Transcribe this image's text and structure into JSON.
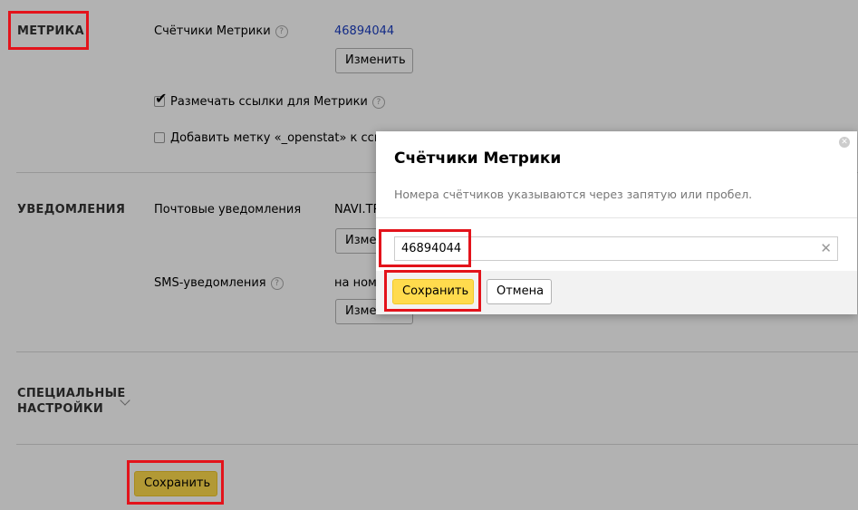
{
  "metrika": {
    "section_title": "МЕТРИКА",
    "counters_label": "Счётчики Метрики",
    "counters_value": "46894044",
    "change_button": "Изменить",
    "mark_links_label": "Размечать ссылки для Метрики",
    "openstat_label": "Добавить метку «_openstat» к ссылка"
  },
  "notifications": {
    "section_title": "УВЕДОМЛЕНИЯ",
    "email_label": "Почтовые уведомления",
    "email_value": "NAVI.TR",
    "email_change": "Изме",
    "sms_label": "SMS-уведомления",
    "sms_value": "на номе",
    "sms_change": "Изме"
  },
  "special": {
    "title_line1": "СПЕЦИАЛЬНЫЕ",
    "title_line2": "НАСТРОЙКИ"
  },
  "footer": {
    "save_button": "Сохранить"
  },
  "modal": {
    "title": "Счётчики Метрики",
    "description": "Номера счётчиков указываются через запятую или пробел.",
    "input_value": "46894044",
    "save_button": "Сохранить",
    "cancel_button": "Отмена"
  },
  "colors": {
    "accent_yellow": "#ffdb4d",
    "highlight_red": "#e3131b",
    "link_blue": "#1a3dc1"
  }
}
